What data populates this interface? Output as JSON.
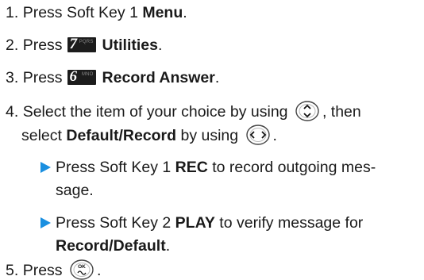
{
  "steps": {
    "s1": {
      "num": "1.",
      "text": "Press Soft Key 1 ",
      "bold": "Menu",
      "end": "."
    },
    "s2": {
      "num": "2.",
      "text": "Press",
      "key_digit": "7",
      "key_sub": "PQRS",
      "bold": "Utilities",
      "end": "."
    },
    "s3": {
      "num": "3.",
      "text": "Press",
      "key_digit": "6",
      "key_sub": "MNO",
      "bold": "Record Answer",
      "end": "."
    },
    "s4": {
      "num": "4.",
      "line1_a": "Select the item of your choice by using",
      "line1_b": ", then",
      "line2_a": "select ",
      "line2_bold": "Default/Record",
      "line2_b": " by using",
      "line2_end": "."
    },
    "s5": {
      "num": "5.",
      "text": "Press",
      "end": "."
    }
  },
  "bullets": {
    "b1": {
      "line1_a": "Press Soft Key 1 ",
      "line1_bold": "REC",
      "line1_b": " to record outgoing mes-",
      "line2": "sage."
    },
    "b2": {
      "line1_a": "Press Soft Key 2 ",
      "line1_bold": "PLAY",
      "line1_b": " to verify message for",
      "line2_bold": "Record/Default",
      "line2_end": "."
    }
  },
  "keys": {
    "ok_label": "OK"
  },
  "colors": {
    "bullet_arrow": "#1a8fe0"
  }
}
